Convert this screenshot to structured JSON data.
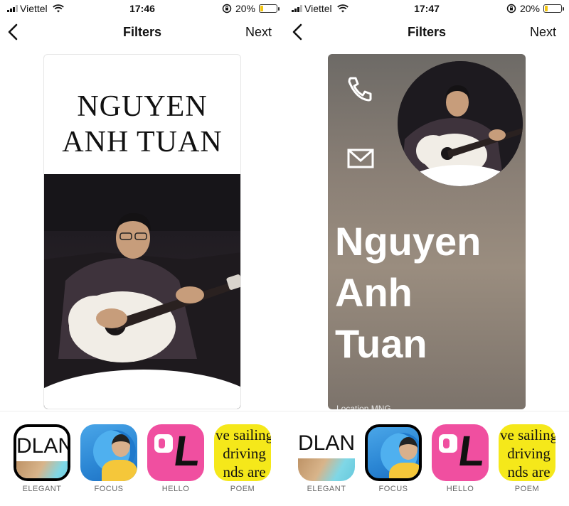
{
  "screens": [
    {
      "status": {
        "carrier": "Viettel",
        "time": "17:46",
        "battery": "20%",
        "battery_level": 0.2
      },
      "nav": {
        "title": "Filters",
        "next": "Next"
      },
      "card": {
        "style": "elegant",
        "name_lines": [
          "NGUYEN",
          "ANH TUAN"
        ]
      }
    },
    {
      "status": {
        "carrier": "Viettel",
        "time": "17:47",
        "battery": "20%",
        "battery_level": 0.2
      },
      "nav": {
        "title": "Filters",
        "next": "Next"
      },
      "card": {
        "style": "focus",
        "name_lines": [
          "Nguyen",
          "Anh",
          "Tuan"
        ],
        "footer": "Location MNG"
      }
    }
  ],
  "filters": [
    {
      "label": "ELEGANT",
      "thumb_text": "DLAN"
    },
    {
      "label": "FOCUS"
    },
    {
      "label": "HELLO",
      "thumb_text": "L"
    },
    {
      "label": "POEM",
      "thumb_lines": [
        "ve sailing",
        "driving",
        "nds are"
      ]
    }
  ],
  "selected_filter": [
    "ELEGANT",
    "FOCUS"
  ],
  "colors": {
    "hello_pink": "#f04fa0",
    "poem_yellow": "#f5e81a",
    "focus_blue": "#2b86d4",
    "battery": "#f2c511"
  }
}
